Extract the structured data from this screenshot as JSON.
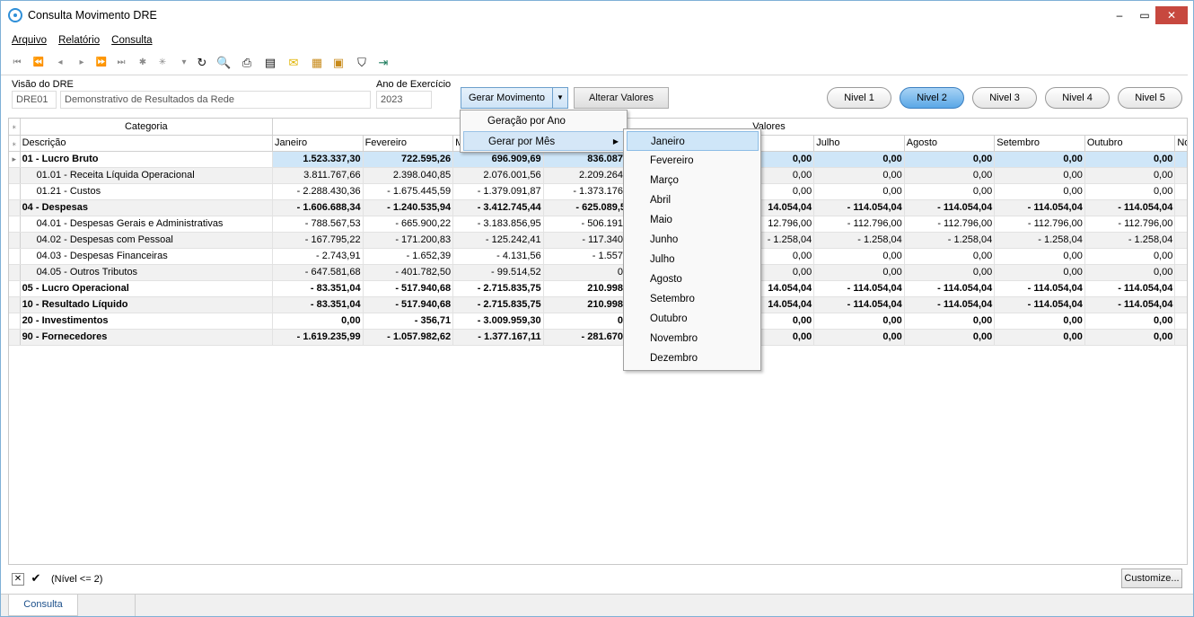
{
  "window": {
    "title": "Consulta Movimento DRE",
    "min": "‒",
    "max": "▭",
    "close": "✕"
  },
  "menu": [
    "Arquivo",
    "Relatório",
    "Consulta"
  ],
  "form": {
    "visao_label": "Visão do DRE",
    "visao_code": "DRE01",
    "visao_desc": "Demonstrativo de Resultados da Rede",
    "ano_label": "Ano de Exercício",
    "ano_value": "2023",
    "gerar_label": "Gerar Movimento",
    "alterar_label": "Alterar Valores"
  },
  "niveis": [
    "Nivel 1",
    "Nivel 2",
    "Nivel 3",
    "Nivel 4",
    "Nivel 5"
  ],
  "grid": {
    "band_categoria": "Categoria",
    "band_valores": "Valores",
    "col_descricao": "Descrição",
    "months": [
      "Janeiro",
      "Fevereiro",
      "Ma",
      "",
      "",
      "",
      "Julho",
      "Agosto",
      "Setembro",
      "Outubro",
      "Nov"
    ],
    "rows": [
      {
        "d": "01 - Lucro Bruto",
        "v": [
          "1.523.337,30",
          "722.595,26",
          "696.909,69",
          "836.087,4",
          "",
          "0,00",
          "0,00",
          "0,00",
          "0,00",
          "0,00"
        ],
        "bold": true,
        "sel": true
      },
      {
        "d": "01.01 - Receita Líquida Operacional",
        "v": [
          "3.811.767,66",
          "2.398.040,85",
          "2.076.001,56",
          "2.209.264,4",
          "",
          "0,00",
          "0,00",
          "0,00",
          "0,00",
          "0,00"
        ]
      },
      {
        "d": "01.21 - Custos",
        "v": [
          "- 2.288.430,36",
          "- 1.675.445,59",
          "- 1.379.091,87",
          "- 1.373.176,7",
          "",
          "0,00",
          "0,00",
          "0,00",
          "0,00",
          "0,00"
        ]
      },
      {
        "d": "04 - Despesas",
        "v": [
          "- 1.606.688,34",
          "- 1.240.535,94",
          "- 3.412.745,44",
          "- 625.089,59",
          "",
          "14.054,04",
          "- 114.054,04",
          "- 114.054,04",
          "- 114.054,04",
          "- 114.054,04"
        ],
        "bold": true
      },
      {
        "d": "04.01 - Despesas Gerais e Administrativas",
        "v": [
          "- 788.567,53",
          "- 665.900,22",
          "- 3.183.856,95",
          "- 506.191,2",
          "",
          "12.796,00",
          "- 112.796,00",
          "- 112.796,00",
          "- 112.796,00",
          "- 112.796,00"
        ]
      },
      {
        "d": "04.02 - Despesas com Pessoal",
        "v": [
          "- 167.795,22",
          "- 171.200,83",
          "- 125.242,41",
          "- 117.340,6",
          "",
          "- 1.258,04",
          "- 1.258,04",
          "- 1.258,04",
          "- 1.258,04",
          "- 1.258,04"
        ]
      },
      {
        "d": "04.03 - Despesas Financeiras",
        "v": [
          "- 2.743,91",
          "- 1.652,39",
          "- 4.131,56",
          "- 1.557,7",
          "",
          "0,00",
          "0,00",
          "0,00",
          "0,00",
          "0,00"
        ]
      },
      {
        "d": "04.05 - Outros Tributos",
        "v": [
          "- 647.581,68",
          "- 401.782,50",
          "- 99.514,52",
          "0,0",
          "",
          "0,00",
          "0,00",
          "0,00",
          "0,00",
          "0,00"
        ]
      },
      {
        "d": "05 - Lucro Operacional",
        "v": [
          "- 83.351,04",
          "- 517.940,68",
          "- 2.715.835,75",
          "210.998,1",
          "",
          "14.054,04",
          "- 114.054,04",
          "- 114.054,04",
          "- 114.054,04",
          "- 114.054,04"
        ],
        "bold": true
      },
      {
        "d": "10 - Resultado Líquido",
        "v": [
          "- 83.351,04",
          "- 517.940,68",
          "- 2.715.835,75",
          "210.998,1",
          "",
          "14.054,04",
          "- 114.054,04",
          "- 114.054,04",
          "- 114.054,04",
          "- 114.054,04"
        ],
        "bold": true
      },
      {
        "d": "20 - Investimentos",
        "v": [
          "0,00",
          "- 356,71",
          "- 3.009.959,30",
          "0,0",
          "",
          "0,00",
          "0,00",
          "0,00",
          "0,00",
          "0,00"
        ],
        "bold": true
      },
      {
        "d": "90 - Fornecedores",
        "v": [
          "- 1.619.235,99",
          "- 1.057.982,62",
          "- 1.377.167,11",
          "- 281.670,2",
          "",
          "0,00",
          "0,00",
          "0,00",
          "0,00",
          "0,00"
        ],
        "bold": true
      }
    ]
  },
  "filter": {
    "text": "(Nível <= 2)",
    "customize": "Customize..."
  },
  "tabs": [
    "Consulta"
  ],
  "menu_gerar": [
    "Geração por Ano",
    "Gerar por Mês"
  ],
  "menu_meses": [
    "Janeiro",
    "Fevereiro",
    "Março",
    "Abril",
    "Maio",
    "Junho",
    "Julho",
    "Agosto",
    "Setembro",
    "Outubro",
    "Novembro",
    "Dezembro"
  ]
}
